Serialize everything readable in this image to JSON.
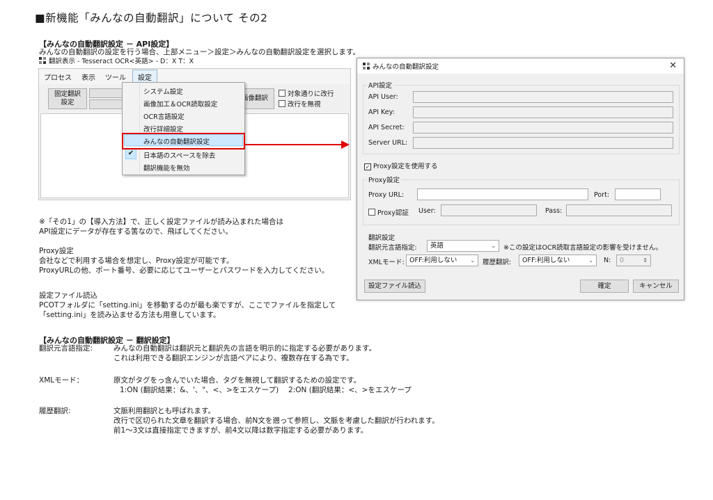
{
  "page": {
    "title": "■新機能「みんなの自動翻訳」について その2"
  },
  "section1": {
    "heading": "【みんなの自動翻訳設定 － API設定】",
    "intro": "みんなの自動翻訳の設定を行う場合、上部メニュー＞設定＞みんなの自動翻訳設定を選択します。"
  },
  "app": {
    "title": "翻訳表示 - Tesseract OCR<英語> - D：X T：X",
    "menus": [
      "プロセス",
      "表示",
      "ツール",
      "設定"
    ],
    "fixed_translation_button": "固定翻訳\n設定",
    "image_translation_button": "画像翻訳",
    "checkbox_target": "対象通りに改行",
    "checkbox_ignore_newline": "改行を無視",
    "dropdown_items": [
      "システム設定",
      "画像加工＆OCR読取設定",
      "OCR言語設定",
      "改行詳細設定",
      "みんなの自動翻訳設定",
      "日本語のスペースを除去",
      "翻訳機能を無効"
    ],
    "checked_item_mark": "✔"
  },
  "notes": {
    "p1_line1": "※「その1」の【導入方法】で、正しく設定ファイルが読み込まれた場合は",
    "p1_line2": "API設定にデータが存在する筈なので、飛ばしてください。",
    "p2_title": "Proxy設定",
    "p2_line1": "会社などで利用する場合を想定し、Proxy設定が可能です。",
    "p2_line2": "ProxyURLの他、ポート番号、必要に応じてユーザーとパスワードを入力してください。",
    "p3_title": "設定ファイル読込",
    "p3_line1": "PCOTフォルダに「setting.ini」を移動するのが最も楽ですが、ここでファイルを指定して",
    "p3_line2": "「setting.ini」を読み込ませる方法も用意しています。"
  },
  "dialog": {
    "title": "みんなの自動翻訳設定",
    "close": "✕",
    "api_group": "API設定",
    "api_user": "API User:",
    "api_key": "API Key:",
    "api_secret": "API Secret:",
    "server_url": "Server URL:",
    "use_proxy": "Proxy設定を使用する",
    "use_proxy_check": "✓",
    "proxy_group": "Proxy設定",
    "proxy_url": "Proxy URL:",
    "port": "Port:",
    "proxy_auth": "Proxy認証",
    "user": "User:",
    "pass": "Pass:",
    "trans_group": "翻訳設定",
    "source_lang_label": "翻訳元言語指定:",
    "source_lang_value": "英語",
    "source_lang_note": "※この設定はOCR読取言語設定の影響を受けません。",
    "xml_mode_label": "XMLモード:",
    "xml_mode_value": "OFF:利用しない",
    "history_label": "履歴翻訳:",
    "history_value": "OFF:利用しない",
    "n_label": "N:",
    "n_value": "0",
    "load_button": "設定ファイル読込",
    "ok_button": "確定",
    "cancel_button": "キャンセル"
  },
  "section2": {
    "heading": "【みんなの自動翻訳設定 － 翻訳設定】",
    "src_label": "翻訳元言語指定:",
    "src_line1": "みんなの自動翻訳は翻訳元と翻訳先の言語を明示的に指定する必要があります。",
    "src_line2": "これは利用できる翻訳エンジンが言語ペアにより、複数存在する為です。",
    "xml_label": "XMLモード：",
    "xml_line1": "原文がタグをっ含んでいた場合、タグを無視して翻訳するための設定です。",
    "xml_line2": "1:ON (翻訳結果：&、'、\"、<、>をエスケープ)　 2:ON (翻訳結果：<、>をエスケープ",
    "hist_label": "履歴翻訳:",
    "hist_line1": "文脈利用翻訳とも呼ばれます。",
    "hist_line2": "改行で区切られた文章を翻訳する場合、前N文を遡って参照し、文脈を考慮した翻訳が行われます。",
    "hist_line3": "前1～3文は直接指定できますが、前4文以降は数字指定する必要があります。"
  }
}
